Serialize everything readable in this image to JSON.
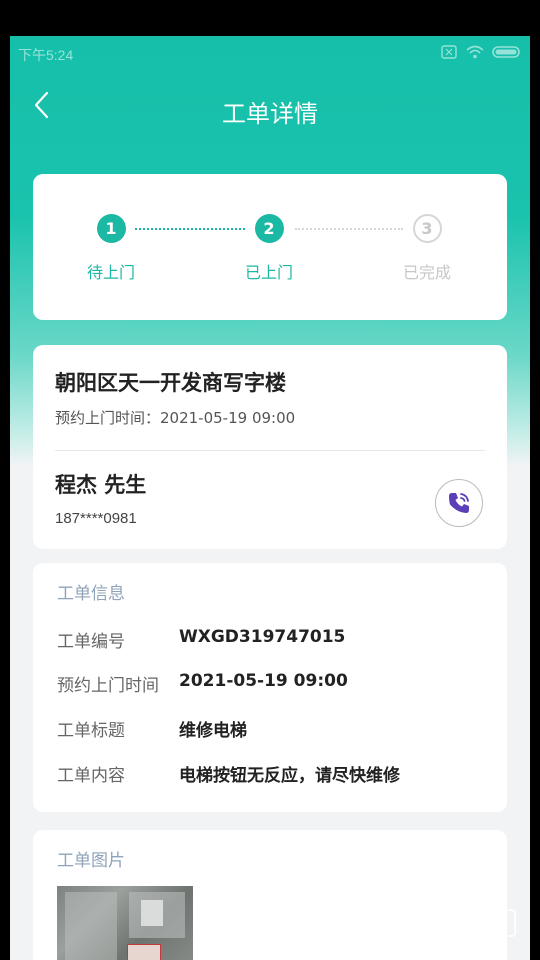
{
  "status_bar": {
    "time": "下午5:24",
    "icons": [
      "sim-icon",
      "wifi-icon",
      "battery-icon"
    ]
  },
  "header": {
    "title": "工单详情",
    "back_icon": "chevron-left-icon"
  },
  "progress": {
    "steps": [
      {
        "number": "1",
        "label": "待上门",
        "state": "active"
      },
      {
        "number": "2",
        "label": "已上门",
        "state": "active"
      },
      {
        "number": "3",
        "label": "已完成",
        "state": "inactive"
      }
    ]
  },
  "address": {
    "title": "朝阳区天一开发商写字楼",
    "appointment": "预约上门时间：2021-05-19 09:00"
  },
  "contact": {
    "name": "程杰 先生",
    "phone": "187****0981",
    "call_icon": "phone-icon"
  },
  "order_info": {
    "section_title": "工单信息",
    "rows": [
      {
        "key": "工单编号",
        "value": "WXGD319747015"
      },
      {
        "key": "预约上门时间",
        "value": "2021-05-19 09:00"
      },
      {
        "key": "工单标题",
        "value": "维修电梯"
      },
      {
        "key": "工单内容",
        "value": "电梯按钮无反应，请尽快维修"
      }
    ]
  },
  "order_images": {
    "section_title": "工单图片"
  },
  "colors": {
    "accent": "#1bb9a4",
    "muted": "#c7c7c7",
    "section_title": "#8fa3b9"
  }
}
